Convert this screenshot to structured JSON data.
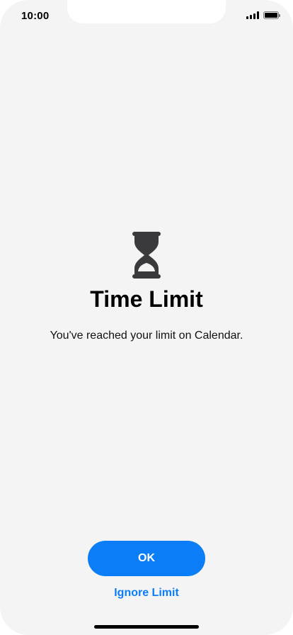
{
  "status_bar": {
    "time": "10:00",
    "icons": [
      "signal-icon",
      "battery-icon"
    ]
  },
  "screen_time": {
    "icon": "hourglass-icon",
    "title": "Time Limit",
    "message": "You've reached your limit on Calendar.",
    "ok_label": "OK",
    "ignore_label": "Ignore Limit"
  },
  "colors": {
    "background": "#f4f4f4",
    "accent": "#0a7df7",
    "icon": "#3a3a3c",
    "text": "#000000"
  }
}
